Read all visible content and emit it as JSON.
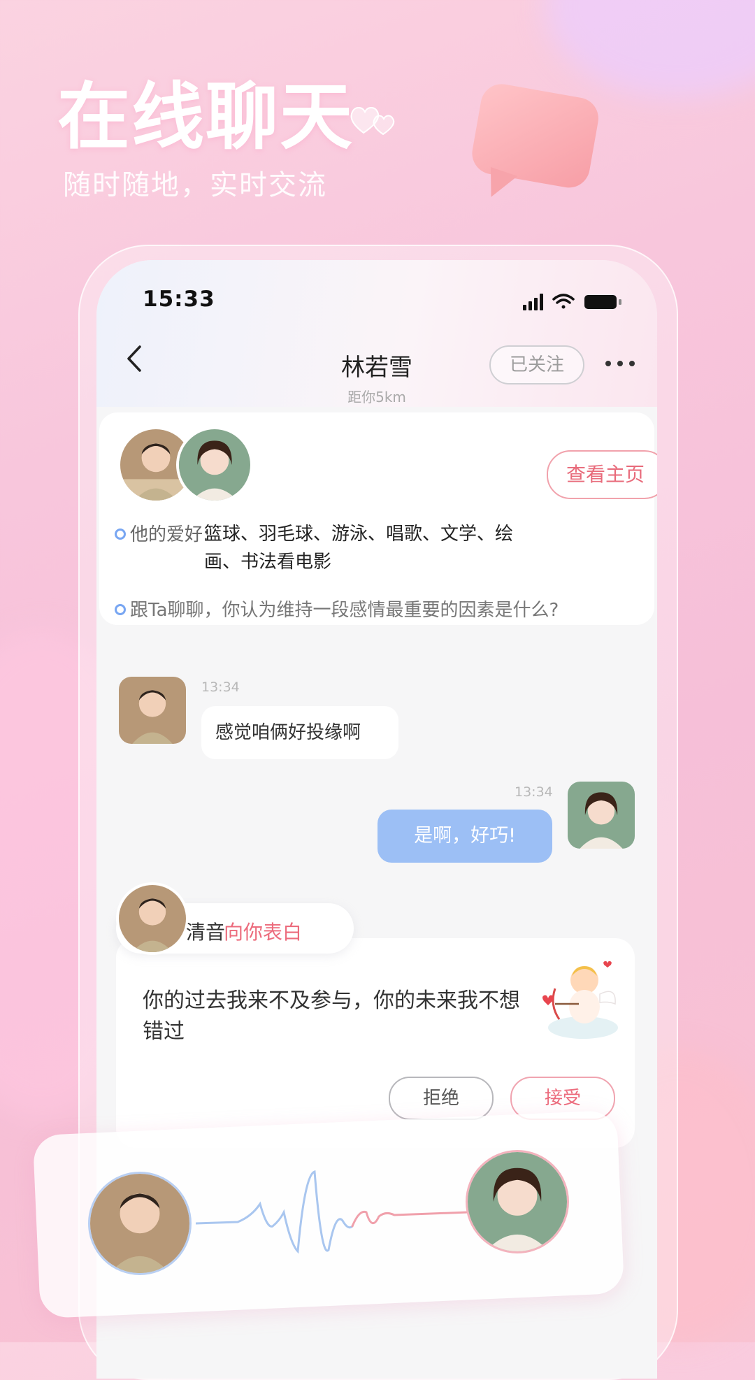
{
  "hero": {
    "title": "在线聊天",
    "subtitle": "随时随地，实时交流"
  },
  "status_bar": {
    "time": "15:33"
  },
  "nav": {
    "name": "林若雪",
    "distance": "距你5km",
    "follow_label": "已关注",
    "back_icon": "chevron-left-icon",
    "more_icon": "more-horizontal-icon"
  },
  "profile": {
    "view_home_label": "查看主页",
    "hobby_label": "他的爱好:",
    "hobby_value": "篮球、羽毛球、游泳、唱歌、文学、绘画、书法看电影",
    "topic": "跟Ta聊聊，你认为维持一段感情最重要的因素是什么?"
  },
  "messages": [
    {
      "side": "left",
      "time": "13:34",
      "text": "感觉咱俩好投缘啊"
    },
    {
      "side": "right",
      "time": "13:34",
      "text": "是啊，好巧!"
    }
  ],
  "confession": {
    "name": "清音",
    "action": "向你表白",
    "text": "你的过去我来不及参与，你的未来我不想错过",
    "reject_label": "拒绝",
    "accept_label": "接受"
  },
  "colors": {
    "accent_pink": "#ec6b7c",
    "bubble_blue": "#9cbff5",
    "background_pink": "#f8c6dc"
  }
}
